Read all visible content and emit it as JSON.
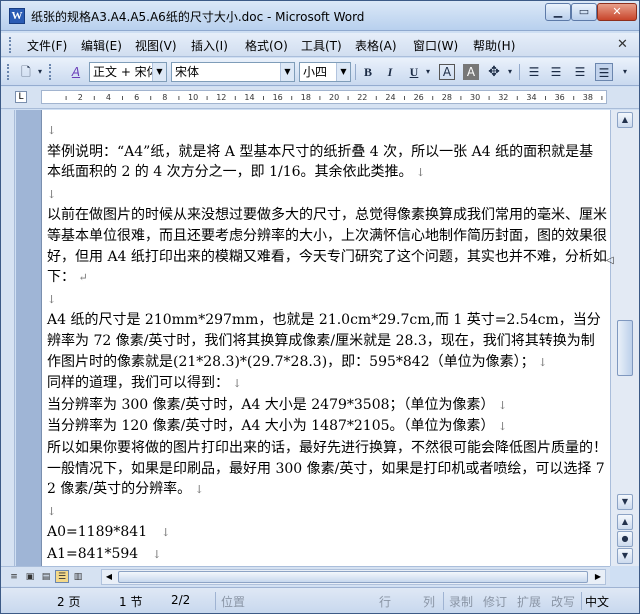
{
  "window": {
    "title": "纸张的规格A3.A4.A5.A6纸的尺寸大小.doc - Microsoft Word",
    "app_icon": "W"
  },
  "menu": [
    "文件(F)",
    "编辑(E)",
    "视图(V)",
    "插入(I)",
    "格式(O)",
    "工具(T)",
    "表格(A)",
    "窗口(W)",
    "帮助(H)"
  ],
  "toolbar": {
    "style_value": "正文 + 宋体",
    "font_value": "宋体",
    "size_value": "小四",
    "bold": "B",
    "italic": "I",
    "underline": "U",
    "text_style_icon": "A",
    "highlight_icon": "A"
  },
  "ruler": {
    "numbers": [
      "2",
      "4",
      "6",
      "8",
      "10",
      "12",
      "14",
      "16",
      "18",
      "20",
      "22",
      "24",
      "26",
      "28",
      "30",
      "32",
      "34",
      "36",
      "38"
    ]
  },
  "document": {
    "paragraphs": [
      {
        "text": "",
        "mark": "↓"
      },
      {
        "text": "举例说明：“A4”纸，就是将 A 型基本尺寸的纸折叠 4 次，所以一张 A4 纸的面积就是基本纸面积的 2 的 4 次方分之一，即 1/16。其余依此类推。",
        "mark": " ↓"
      },
      {
        "text": "",
        "mark": "↓"
      },
      {
        "text": "以前在做图片的时候从来没想过要做多大的尺寸，总觉得像素换算成我们常用的毫米、厘米等基本单位很难，而且还要考虑分辨率的大小，上次满怀信心地制作简历封面，图的效果很好，但用 A4 纸打印出来的模糊又难看，今天专门研究了这个问题，其实也并不难，分析如下：",
        "mark": " ↵"
      },
      {
        "text": "",
        "mark": "↓"
      },
      {
        "text": "A4 纸的尺寸是 210mm*297mm，也就是 21.0cm*29.7cm,而 1 英寸=2.54cm，当分辨率为 72 像素/英寸时，我们将其换算成像素/厘米就是 28.3，现在，我们将其转换为制作图片时的像素就是(21*28.3)*(29.7*28.3)，即：595*842（单位为像素）；",
        "mark": " ↓"
      },
      {
        "text": "同样的道理，我们可以得到：",
        "mark": " ↓"
      },
      {
        "text": "当分辨率为 300 像素/英寸时，A4 大小是 2479*3508；（单位为像素）",
        "mark": " ↓"
      },
      {
        "text": "当分辨率为 120 像素/英寸时，A4 大小为 1487*2105。（单位为像素）",
        "mark": " ↓"
      },
      {
        "text": "所以如果你要将做的图片打印出来的话，最好先进行换算，不然很可能会降低图片质量的！一般情况下，如果是印刷品，最好用 300 像素/英寸，如果是打印机或者喷绘，可以选择 72 像素/英寸的分辨率。",
        "mark": " ↓"
      },
      {
        "text": "",
        "mark": "↓"
      },
      {
        "text": "A0=1189*841",
        "mark": "    ↓"
      },
      {
        "text": "A1=841*594",
        "mark": "    ↓"
      }
    ]
  },
  "statusbar": {
    "page": "2 页",
    "section": "1 节",
    "pages": "2/2",
    "position": "位置",
    "line": "行",
    "column": "列",
    "rec": "录制",
    "trk": "修订",
    "ext": "扩展",
    "ovr": "改写",
    "lang": "中文"
  }
}
